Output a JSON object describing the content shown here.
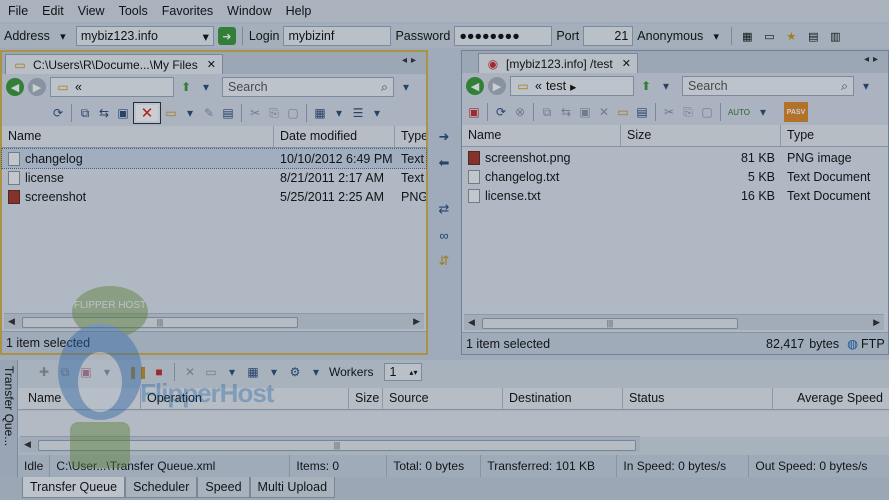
{
  "menu": [
    "File",
    "Edit",
    "View",
    "Tools",
    "Favorites",
    "Window",
    "Help"
  ],
  "address": {
    "address_label": "Address",
    "site": "mybiz123.info",
    "login_label": "Login",
    "login": "mybizinf",
    "password_label": "Password",
    "password": "●●●●●●●●",
    "port_label": "Port",
    "port": "21",
    "anonymous_label": "Anonymous"
  },
  "left_pane": {
    "tab": "C:\\Users\\R\\Docume...\\My Files",
    "path": "«",
    "search_placeholder": "Search",
    "columns": [
      "Name",
      "Date modified",
      "Type"
    ],
    "rows": [
      {
        "name": "changelog",
        "date": "10/10/2012 6:49 PM",
        "type": "Text",
        "selected": true,
        "icon": "text-file-icon"
      },
      {
        "name": "license",
        "date": "8/21/2011 2:17 AM",
        "type": "Text",
        "selected": false,
        "icon": "text-file-icon"
      },
      {
        "name": "screenshot",
        "date": "5/25/2011 2:25 AM",
        "type": "PNG",
        "selected": false,
        "icon": "image-file-icon"
      }
    ],
    "status": "1 item selected"
  },
  "right_pane": {
    "tab": "[mybiz123.info] /test",
    "path_prefix": "«",
    "path": "test",
    "search_placeholder": "Search",
    "columns": [
      "Name",
      "Size",
      "Type"
    ],
    "rows": [
      {
        "name": "screenshot.png",
        "size": "81 KB",
        "type": "PNG image",
        "icon": "image-file-icon"
      },
      {
        "name": "changelog.txt",
        "size": "5 KB",
        "type": "Text Document",
        "icon": "text-file-icon"
      },
      {
        "name": "license.txt",
        "size": "16 KB",
        "type": "Text Document",
        "icon": "text-file-icon"
      }
    ],
    "status": "1 item selected",
    "bytes": "82,417",
    "bytes_label": "bytes",
    "protocol": "FTP",
    "pasv": "PASV",
    "auto": "AUTO"
  },
  "queue": {
    "side_label": "Transfer Que...",
    "workers_label": "Workers",
    "workers": "1",
    "columns": [
      "Name",
      "Operation",
      "Size",
      "Source",
      "Destination",
      "Status",
      "Average Speed"
    ],
    "status": {
      "state": "Idle",
      "file": "C:\\User...\\Transfer Queue.xml",
      "items": "Items: 0",
      "total": "Total: 0 bytes",
      "transferred": "Transferred: 101 KB",
      "in_speed": "In Speed: 0 bytes/s",
      "out_speed": "Out Speed: 0 bytes/s"
    }
  },
  "bottom_tabs": [
    "Transfer Queue",
    "Scheduler",
    "Speed",
    "Multi Upload"
  ],
  "watermark": {
    "badge": "FLIPPER HOST",
    "text": "FlipperHost"
  }
}
